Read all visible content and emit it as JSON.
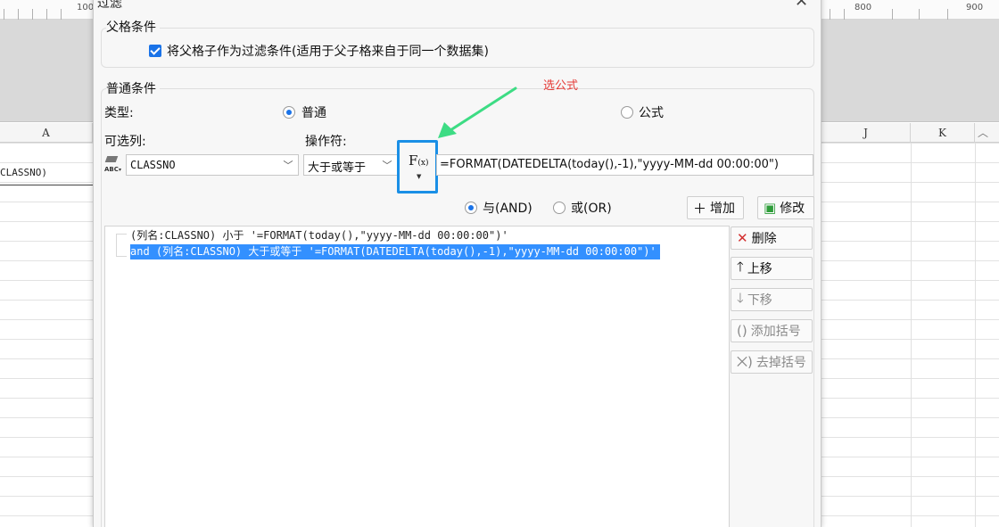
{
  "ruler": {
    "n100": "100",
    "n800": "800",
    "n900": "900"
  },
  "sheet": {
    "columns": [
      "A",
      "J",
      "K"
    ],
    "cell_value": "CLASSNO)"
  },
  "dialog": {
    "title": "过滤",
    "parent_group": {
      "title": "父格条件",
      "checkbox_label": "将父格子作为过滤条件(适用于父子格来自于同一个数据集)",
      "checked": true
    },
    "normal_group": {
      "title": "普通条件",
      "type_label": "类型:",
      "type_options": [
        "普通",
        "公式"
      ],
      "type_selected": "普通",
      "column_label": "可选列:",
      "column_value": "CLASSNO",
      "operator_label": "操作符:",
      "operator_value": "大于或等于",
      "fx_label": "F",
      "fx_sub": "(x)",
      "value_text": "=FORMAT(DATEDELTA(today(),-1),\"yyyy-MM-dd 00:00:00\")",
      "logic_options": [
        "与(AND)",
        "或(OR)"
      ],
      "logic_selected": "与(AND)",
      "add_button": "增加",
      "modify_button": "修改"
    },
    "conditions": [
      "(列名:CLASSNO) 小于 '=FORMAT(today(),\"yyyy-MM-dd 00:00:00\")'",
      "and (列名:CLASSNO) 大于或等于 '=FORMAT(DATEDELTA(today(),-1),\"yyyy-MM-dd 00:00:00\")'"
    ],
    "side_buttons": {
      "delete": "删除",
      "move_up": "上移",
      "move_down": "下移",
      "add_bracket": "添加括号",
      "remove_bracket": "去掉括号"
    }
  },
  "annotation": {
    "text": "选公式",
    "color": "#e53935"
  },
  "colors": {
    "accent": "#1a73e8",
    "highlight_box": "#1a8fe6",
    "arrow": "#3ddc84",
    "selection": "#3390ff"
  }
}
